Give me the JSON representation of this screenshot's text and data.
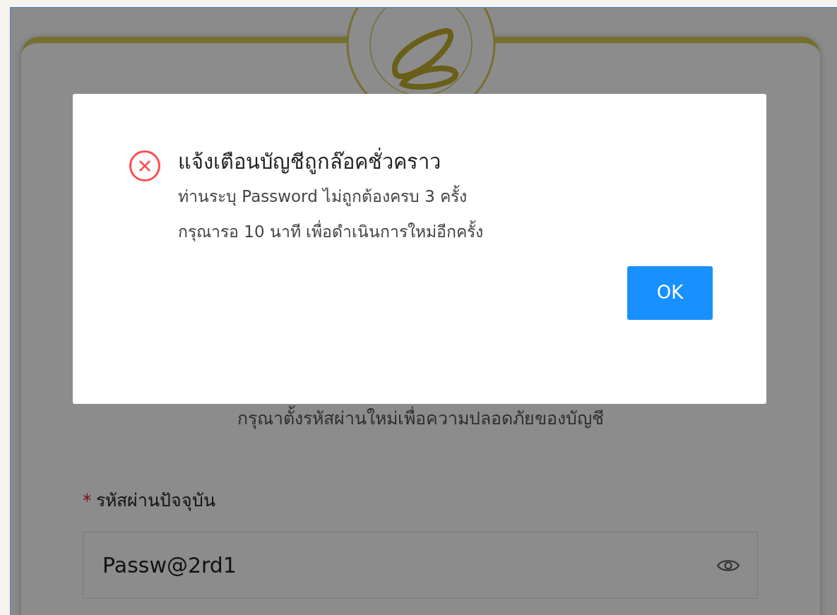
{
  "page": {
    "subtitle": "กรุณาตั้งรหัสผ่านใหม่เพื่อความปลอดภัยของบัญชี"
  },
  "field": {
    "required_mark": "*",
    "label": "รหัสผ่านปัจจุบัน",
    "value": "Passw@2rd1"
  },
  "dialog": {
    "kind": "error",
    "title": "แจ้งเตือนบัญชีถูกล๊อคชั่วคราว",
    "message_lines": [
      "ท่านระบุ Password ไม่ถูกต้องครบ 3 ครั้ง",
      "กรุณารอ 10 นาที เพื่อดำเนินการใหม่อีกครั้ง"
    ],
    "button": "OK"
  }
}
